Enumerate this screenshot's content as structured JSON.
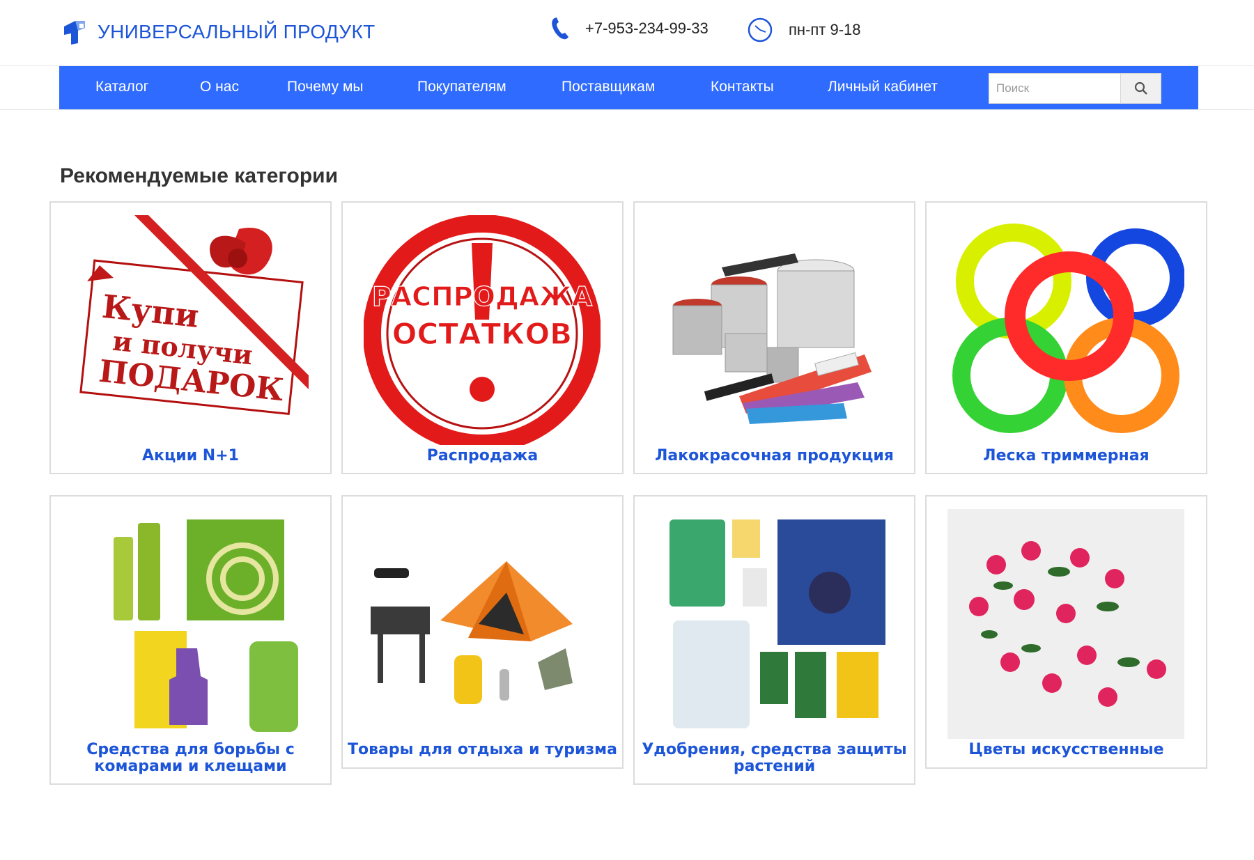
{
  "brand": {
    "name": "УНИВЕРСАЛЬНЫЙ ПРОДУКТ",
    "color": "#1d55d8"
  },
  "contacts": {
    "phone": "+7-953-234-99-33",
    "hours": "пн-пт 9-18",
    "phone_icon": "phone-icon",
    "hours_icon": "clock-icon"
  },
  "nav": {
    "background": "#2f6bff",
    "items": [
      "Каталог",
      "О нас",
      "Почему мы",
      "Покупателям",
      "Поставщикам",
      "Контакты",
      "Личный кабинет"
    ],
    "search_placeholder": "Поиск",
    "search_icon": "search-icon"
  },
  "section": {
    "title": "Рекомендуемые категории",
    "categories": [
      {
        "title": "Акции N+1",
        "image_text": [
          "Купи",
          "и получи",
          "ПОДАРОК"
        ]
      },
      {
        "title": "Распродажа",
        "image_text": [
          "РАСПРОДАЖА",
          "ОСТАТКОВ"
        ]
      },
      {
        "title": "Лакокрасочная продукция"
      },
      {
        "title": "Леска триммерная"
      },
      {
        "title": "Средства для борьбы с комарами и клещами"
      },
      {
        "title": "Товары для отдыха и туризма"
      },
      {
        "title": "Удобрения, средства защиты растений"
      },
      {
        "title": "Цветы искусственные"
      }
    ]
  }
}
